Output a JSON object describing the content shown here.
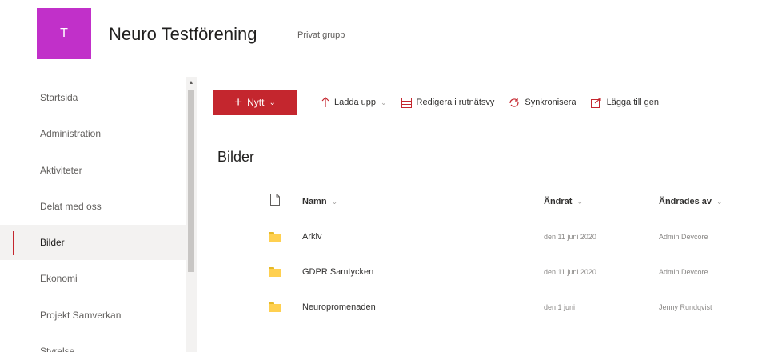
{
  "site": {
    "logo_letter": "T",
    "logo_color": "#c130c9",
    "title": "Neuro Testförening",
    "subtitle": "Privat grupp"
  },
  "nav": {
    "items": [
      {
        "label": "Startsida",
        "selected": false
      },
      {
        "label": "Administration",
        "selected": false
      },
      {
        "label": "Aktiviteter",
        "selected": false
      },
      {
        "label": "Delat med oss",
        "selected": false
      },
      {
        "label": "Bilder",
        "selected": true
      },
      {
        "label": "Ekonomi",
        "selected": false
      },
      {
        "label": "Projekt Samverkan",
        "selected": false
      },
      {
        "label": "Styrelse",
        "selected": false
      }
    ]
  },
  "toolbar": {
    "new_label": "Nytt",
    "upload_label": "Ladda upp",
    "grid_edit_label": "Redigera i rutnätsvy",
    "sync_label": "Synkronisera",
    "add_shortcut_label": "Lägga till gen"
  },
  "library": {
    "title": "Bilder",
    "columns": {
      "name": "Namn",
      "modified": "Ändrat",
      "modified_by": "Ändrades av"
    },
    "rows": [
      {
        "icon": "folder-icon",
        "name": "Arkiv",
        "modified": "den 11 juni 2020",
        "modified_by": "Admin Devcore"
      },
      {
        "icon": "folder-icon",
        "name": "GDPR Samtycken",
        "modified": "den 11 juni 2020",
        "modified_by": "Admin Devcore"
      },
      {
        "icon": "folder-icon",
        "name": "Neuropromenaden",
        "modified": "den 1 juni",
        "modified_by": "Jenny Rundqvist"
      }
    ]
  },
  "colors": {
    "accent": "#c4262e",
    "folder": "#ffd050",
    "selected_nav_bg": "#f3f2f1"
  }
}
